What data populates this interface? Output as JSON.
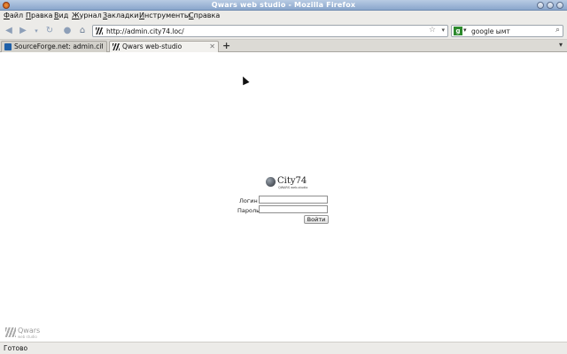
{
  "window": {
    "title": "Qwars web studio - Mozilla Firefox"
  },
  "menu": [
    "Файл",
    "Правка",
    "Вид",
    "Журнал",
    "Закладки",
    "Инструменты",
    "Справка"
  ],
  "navbar": {
    "url": "http://admin.city74.loc/",
    "search_query": "google ымт",
    "search_engine_letter": "g"
  },
  "tabs": [
    {
      "label": "SourceForge.net: admin.cit...",
      "active": false
    },
    {
      "label": "Qwars web-studio",
      "active": true
    }
  ],
  "page": {
    "logo_name": "City74",
    "logo_sub": "QWARS web-studio",
    "login_label": "Логин",
    "password_label": "Пароль",
    "submit_label": "Войти",
    "corner_name": "Qwars",
    "corner_sub": "web studio"
  },
  "status": {
    "text": "Готово"
  }
}
